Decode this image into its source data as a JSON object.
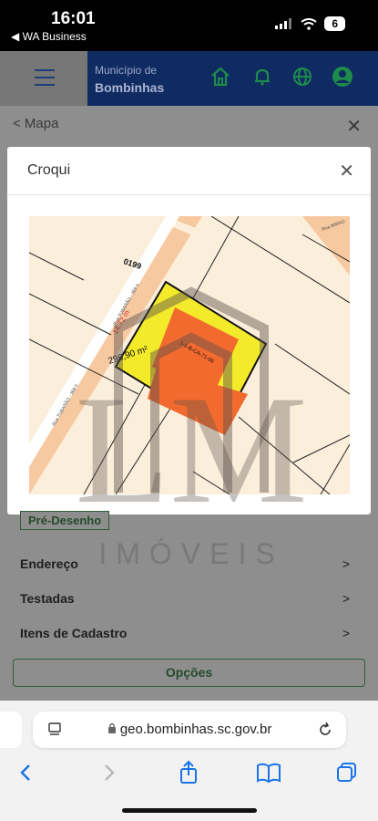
{
  "status": {
    "time": "16:01",
    "back_app": "◀ WA Business",
    "battery": "6"
  },
  "header": {
    "municipio": "Município de",
    "city": "Bombinhas"
  },
  "nav": {
    "back_link": "< Mapa",
    "close": "✕"
  },
  "modal": {
    "title": "Croqui",
    "close": "✕",
    "map_labels": {
      "quadra": "0199",
      "dimension": "14,72 m",
      "area": "298,90 m²",
      "lot": "1-1-B-CA-71-06",
      "street_1": "Rua TUBARÃO - 369 II",
      "street_2": "Rua TUBARÃO - 369 II",
      "street_3": "Rua MIRAÚ"
    }
  },
  "panel": {
    "badge": "Pré-Desenho",
    "rows": [
      "Endereço",
      "Testadas",
      "Itens de Cadastro"
    ],
    "chevron": ">",
    "options_button": "Opções"
  },
  "watermark": {
    "letters": "LM",
    "word": "IMÓVEIS"
  },
  "browser": {
    "url": "geo.bombinhas.sc.gov.br"
  },
  "colors": {
    "brand": "#0f2b61",
    "accent_green": "#1e8a4c",
    "parcel_yellow": "#f3ea2a",
    "building_orange": "#f26a2e",
    "road_peach": "#f7c9a0",
    "safari_blue": "#1a73e8"
  }
}
